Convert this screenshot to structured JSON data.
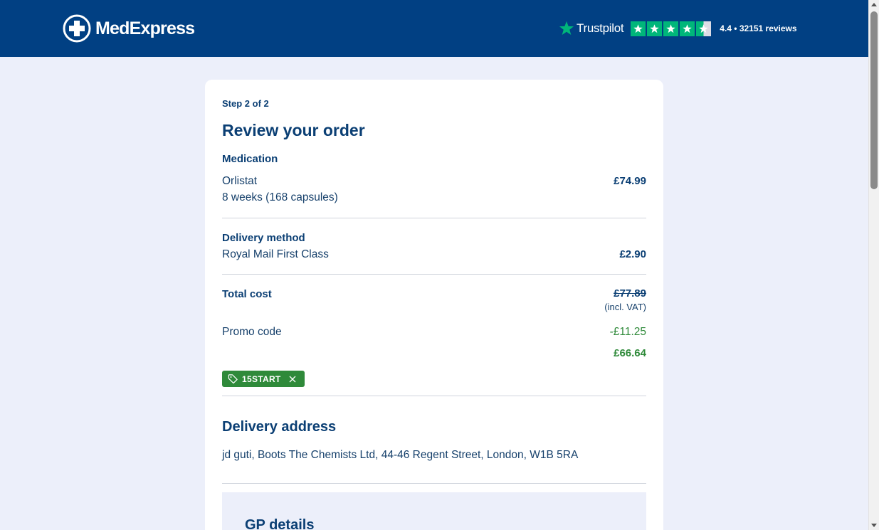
{
  "header": {
    "logo_text": "MedExpress",
    "trustpilot_name": "Trustpilot",
    "rating_text": "4.4 • 32151 reviews",
    "stars_filled": 4.5,
    "colors": {
      "brand": "#014083",
      "trustpilot_green": "#00b67a"
    }
  },
  "order": {
    "step": "Step 2 of 2",
    "title": "Review your order",
    "medication": {
      "label": "Medication",
      "name": "Orlistat",
      "detail": "8 weeks (168 capsules)",
      "price": "£74.99"
    },
    "delivery": {
      "label": "Delivery method",
      "method": "Royal Mail First Class",
      "price": "£2.90"
    },
    "total": {
      "label": "Total cost",
      "original": "£77.89",
      "vat": "(incl. VAT)",
      "promo_label": "Promo code",
      "discount": "-£11.25",
      "final": "£66.64"
    },
    "promo_tag": {
      "code": "15START",
      "color": "#2f8a3a"
    },
    "address": {
      "title": "Delivery address",
      "text": "jd guti, Boots The Chemists Ltd, 44-46 Regent Street, London, W1B 5RA"
    },
    "gp": {
      "title": "GP details"
    }
  }
}
